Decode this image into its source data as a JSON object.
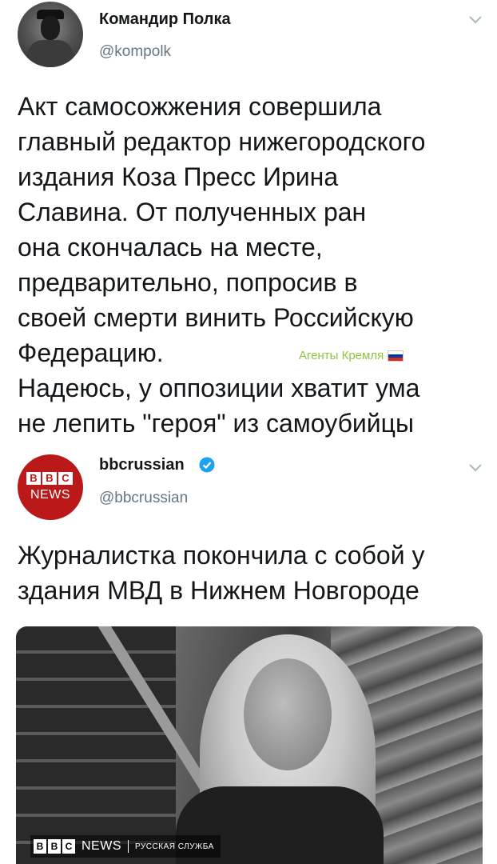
{
  "tweet1": {
    "author_name": "Командир Полка",
    "handle": "@kompolk",
    "lines": [
      "Акт самосожжения совершила",
      "главный редактор нижегородского",
      "издания Коза Пресс Ирина",
      "Славина. От полученных ран",
      "она скончалась на месте,",
      "предварительно, попросив в",
      "своей смерти винить Российскую",
      "Федерацию.",
      "Надеюсь, у оппозиции хватит ума",
      "не лепить \"героя\" из самоубийцы"
    ],
    "overlay_label": "Агенты Кремля"
  },
  "tweet2": {
    "author_name": "bbcrussian",
    "handle": "@bbcrussian",
    "avatar_letters": [
      "B",
      "B",
      "C"
    ],
    "avatar_news": "NEWS",
    "lines": [
      "Журналистка покончила с собой у",
      "здания МВД в Нижнем Новгороде"
    ],
    "banner": {
      "letters": [
        "B",
        "B",
        "C"
      ],
      "news": "NEWS",
      "service": "РУССКАЯ СЛУЖБА"
    }
  },
  "colors": {
    "text": "#14171a",
    "secondary": "#657786",
    "verified": "#1da1f2",
    "bbc_red": "#bb1919",
    "overlay_green": "#8cc63e"
  },
  "icons": [
    "chevron-down-icon",
    "verified-icon",
    "russian-flag-icon"
  ]
}
